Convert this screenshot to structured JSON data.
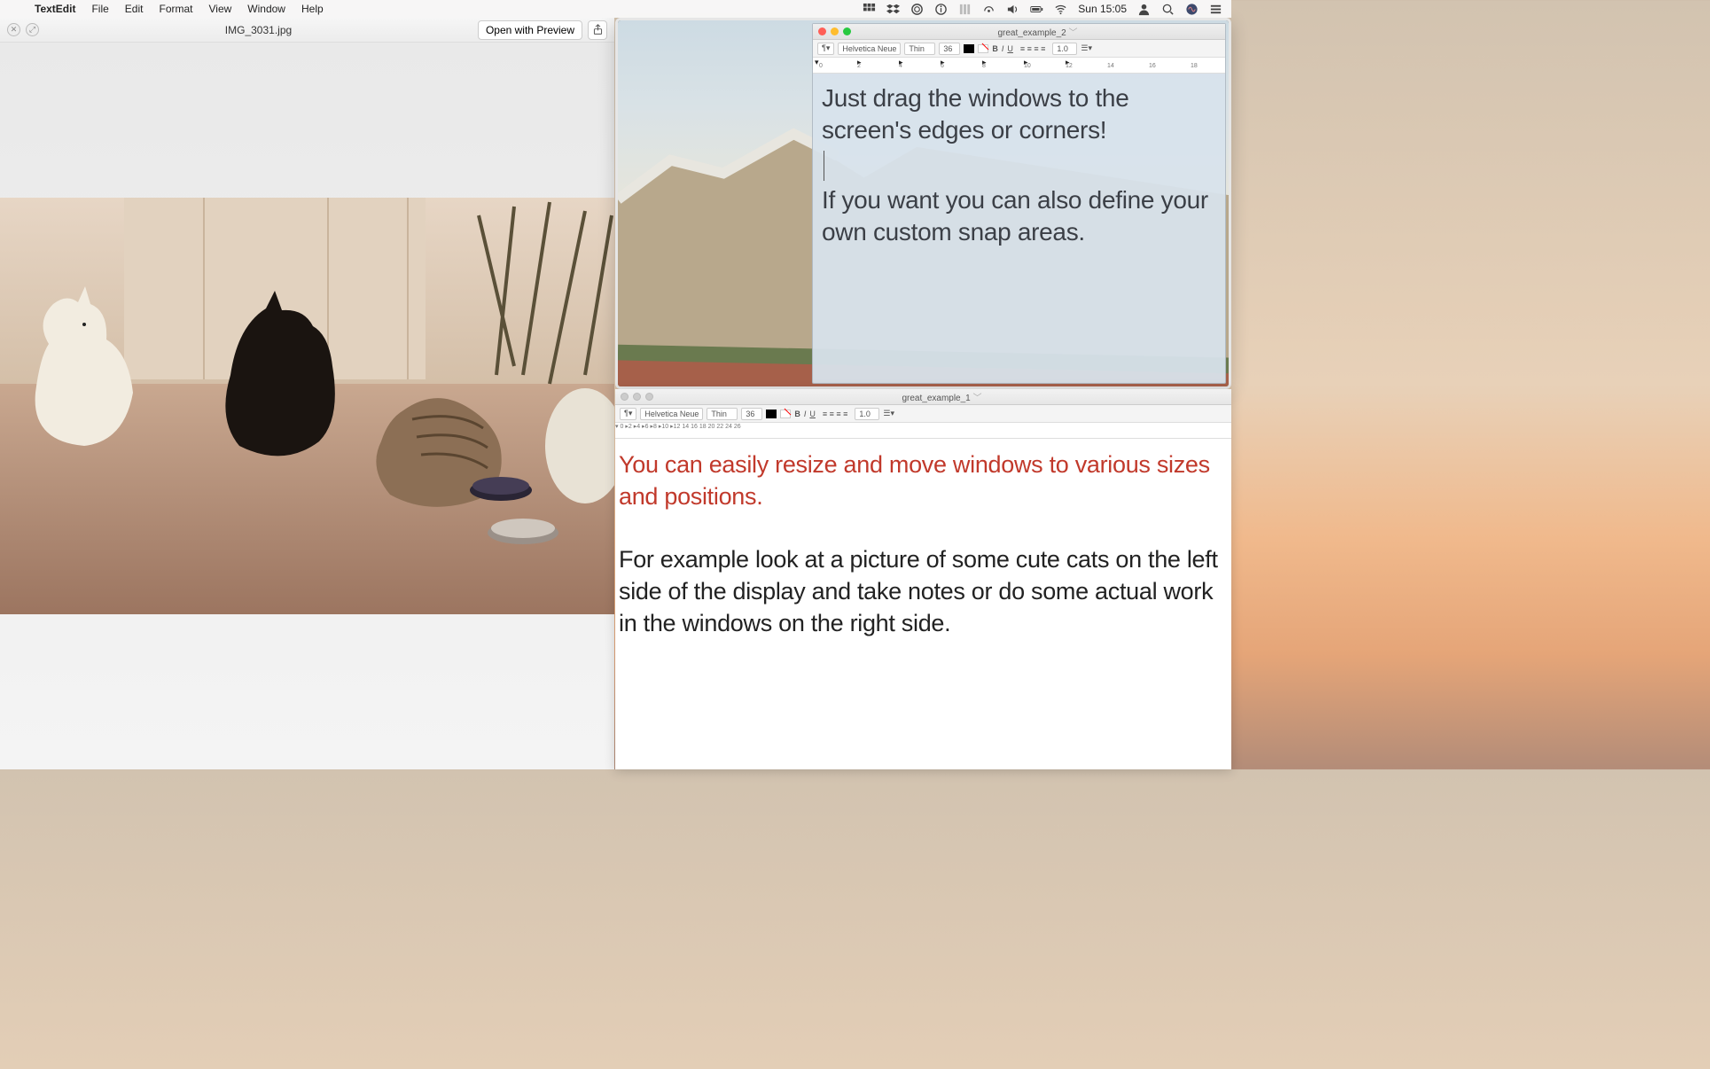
{
  "menubar": {
    "app": "TextEdit",
    "items": [
      "File",
      "Edit",
      "Format",
      "View",
      "Window",
      "Help"
    ],
    "clock": "Sun 15:05"
  },
  "quicklook": {
    "title": "IMG_3031.jpg",
    "open_button": "Open with Preview"
  },
  "snap_window": {
    "title": "great_example_2",
    "toolbar": {
      "font": "Helvetica Neue",
      "weight": "Thin",
      "size": "36",
      "text_color": "#000000",
      "spacing": "1.0"
    },
    "ruler_marks": [
      0,
      2,
      4,
      6,
      8,
      10,
      12,
      14,
      16,
      18
    ],
    "text_line1": "Just drag the windows to the screen's edges or corners!",
    "text_line2": "If you want you can also define your own custom snap areas."
  },
  "editor1": {
    "title": "great_example_1",
    "toolbar": {
      "font": "Helvetica Neue",
      "weight": "Thin",
      "size": "36",
      "text_color": "#000000",
      "spacing": "1.0"
    },
    "ruler_marks": [
      0,
      2,
      4,
      6,
      8,
      10,
      12,
      14,
      16,
      18,
      20,
      22,
      24,
      26
    ],
    "p1": "You can easily resize and move windows to various sizes and positions.",
    "p2": "For example look at a picture of some cute cats on the left side of the display and take notes or do some actual work in the windows on the right side."
  }
}
